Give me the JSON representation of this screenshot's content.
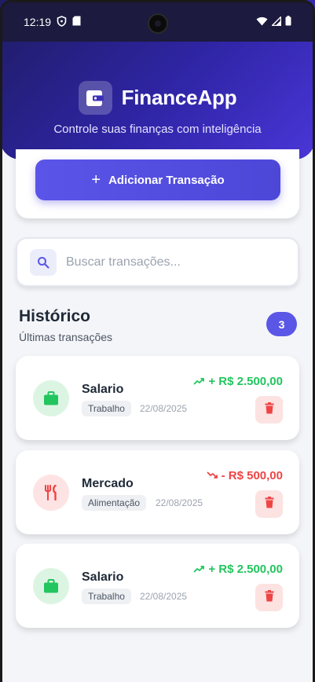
{
  "status_bar": {
    "time": "12:19"
  },
  "app": {
    "title": "FinanceApp",
    "subtitle": "Controle suas finanças com inteligência"
  },
  "actions": {
    "add_label": "Adicionar Transação"
  },
  "search": {
    "placeholder": "Buscar transações...",
    "value": ""
  },
  "history": {
    "title": "Histórico",
    "subtitle": "Últimas transações",
    "count": "3"
  },
  "transactions": [
    {
      "name": "Salario",
      "category": "Trabalho",
      "date": "22/08/2025",
      "amount": "+ R$ 2.500,00",
      "type": "income",
      "icon": "briefcase-icon"
    },
    {
      "name": "Mercado",
      "category": "Alimentação",
      "date": "22/08/2025",
      "amount": "- R$ 500,00",
      "type": "expense",
      "icon": "utensils-icon"
    },
    {
      "name": "Salario",
      "category": "Trabalho",
      "date": "22/08/2025",
      "amount": "+ R$ 2.500,00",
      "type": "income",
      "icon": "briefcase-icon"
    }
  ],
  "colors": {
    "primary": "#5b57e6",
    "income": "#22c55e",
    "expense": "#ef4444",
    "hero_start": "#1f1c64",
    "hero_end": "#4a36d8"
  }
}
